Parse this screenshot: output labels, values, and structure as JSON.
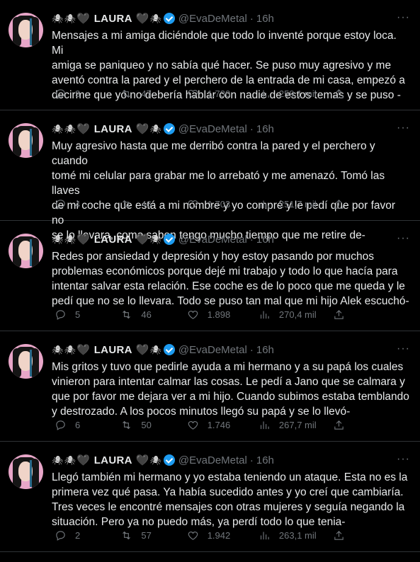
{
  "author": {
    "spider": "🕷",
    "heart": "🖤",
    "name": "LAURA",
    "handle": "@EvaDeMetal",
    "dot": "·",
    "time": "16h",
    "more": "···"
  },
  "tweets": [
    {
      "text": "Mensajes a mi amiga diciéndole que todo lo inventé porque estoy loca. Mi\namiga se paniqueo y no sabía qué hacer. Se puso muy agresivo y me\naventó contra la pared y el perchero de la entrada de mi casa, empezó a\ndecirme que yo no debería hablar con nadie de estos temas y se puso -",
      "replies": "3",
      "retweets": "47",
      "likes": "1.730",
      "views": "259,1 mil"
    },
    {
      "text": "Muy agresivo hasta que me derribó contra la pared y el perchero y cuando\ntomé mi celular para grabar me lo arrebató y me amenazó. Tomó las llaves\nde mi coche que está a mi nombre y yo compré y le pedí que por favor no\nse lo llevara, como saben tengo mucho tiempo que me retire de-",
      "replies": "4",
      "retweets": "46",
      "likes": "1.703",
      "views": "251,7 mil"
    },
    {
      "text": "Redes por ansiedad y depresión y hoy estoy pasando por muchos\nproblemas económicos porque dejé mi trabajo y todo lo que hacía para\nintentar salvar esta relación. Ese coche es de lo poco que me queda y le\npedí que no se lo llevara. Todo se puso tan mal que mi hijo Alek escuchó-",
      "replies": "5",
      "retweets": "46",
      "likes": "1.898",
      "views": "270,4 mil"
    },
    {
      "text": "Mis gritos y tuvo que pedirle ayuda a mi hermano y a su papá los cuales\nvinieron para intentar calmar las cosas. Le pedí a Jano que se calmara y\nque por favor me dejara ver a mi hijo. Cuando subimos estaba temblando\ny destrozado. A los pocos minutos llegó su papá y se lo llevó-",
      "replies": "6",
      "retweets": "50",
      "likes": "1.746",
      "views": "267,7 mil"
    },
    {
      "text": "Llegó también mi hermano y yo estaba teniendo un ataque. Esta no es la\nprimera vez qué pasa. Ya había sucedido antes y yo creí que cambiaría.\nTres veces le encontré mensajes con otras mujeres y seguía negando la\nsituación. Pero ya no puedo más, ya perdí todo lo que tenia-",
      "replies": "2",
      "retweets": "57",
      "likes": "1.942",
      "views": "263,1 mil"
    }
  ]
}
